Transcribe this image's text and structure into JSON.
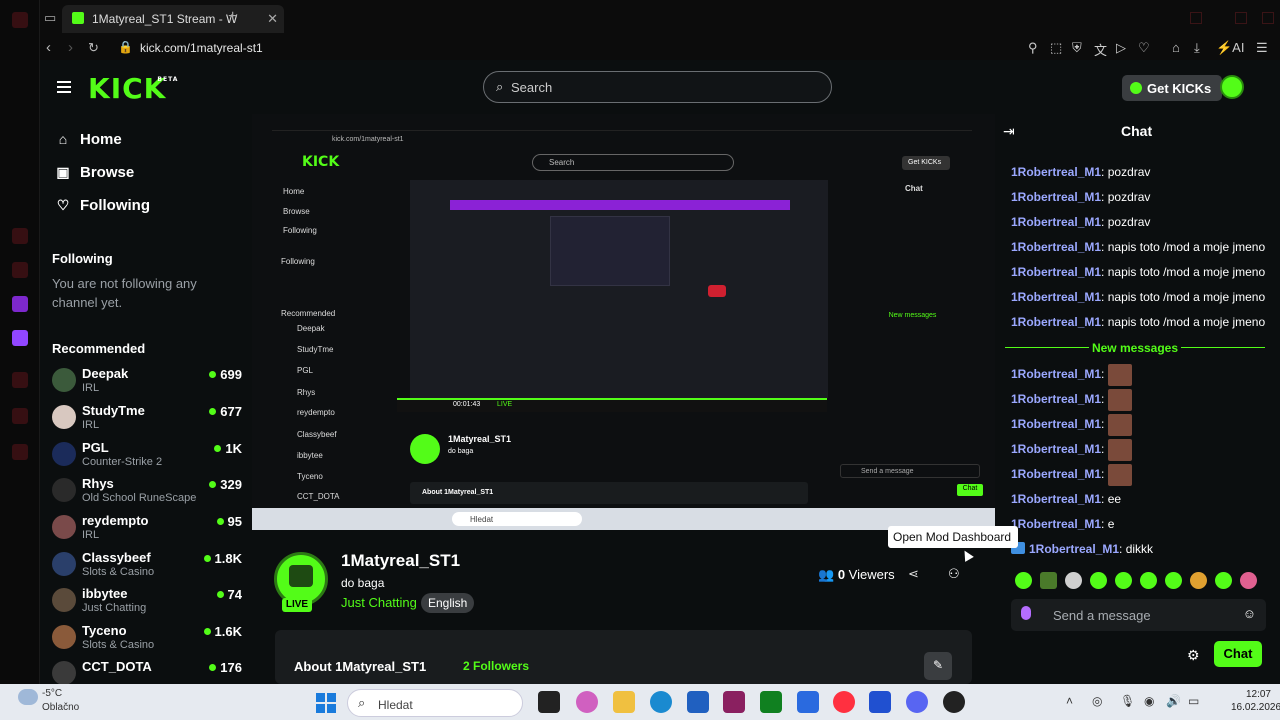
{
  "browser": {
    "tab_title": "1Matyreal_ST1 Stream - W",
    "url": "kick.com/1matyreal-st1"
  },
  "header": {
    "logo": "KICK",
    "logo_sup": "BETA",
    "search_placeholder": "Search",
    "get_kicks": "Get KICKs"
  },
  "sidebar": {
    "nav": [
      {
        "label": "Home",
        "icon": "home-icon"
      },
      {
        "label": "Browse",
        "icon": "browse-icon"
      },
      {
        "label": "Following",
        "icon": "heart-icon"
      }
    ],
    "following_heading": "Following",
    "not_following": "You are not following any channel yet.",
    "recommended_heading": "Recommended",
    "recommended": [
      {
        "name": "Deepak",
        "category": "IRL",
        "viewers": "699"
      },
      {
        "name": "StudyTme",
        "category": "IRL",
        "viewers": "677"
      },
      {
        "name": "PGL",
        "category": "Counter-Strike 2",
        "viewers": "1K"
      },
      {
        "name": "Rhys",
        "category": "Old School RuneScape",
        "viewers": "329"
      },
      {
        "name": "reydempto",
        "category": "IRL",
        "viewers": "95"
      },
      {
        "name": "Classybeef",
        "category": "Slots & Casino",
        "viewers": "1.8K"
      },
      {
        "name": "ibbytee",
        "category": "Just Chatting",
        "viewers": "74"
      },
      {
        "name": "Tyceno",
        "category": "Slots & Casino",
        "viewers": "1.6K"
      },
      {
        "name": "CCT_DOTA",
        "category": "",
        "viewers": "176"
      }
    ]
  },
  "channel": {
    "name": "1Matyreal_ST1",
    "title": "do baga",
    "category": "Just Chatting",
    "language": "English",
    "live": "LIVE",
    "viewers_count": "0",
    "viewers_label": "Viewers",
    "about": "About 1Matyreal_ST1",
    "followers": "2 Followers"
  },
  "tooltip": "Open Mod Dashboard",
  "chat": {
    "title": "Chat",
    "messages": [
      {
        "user": "1Robertreal_M1",
        "text": "pozdrav"
      },
      {
        "user": "1Robertreal_M1",
        "text": "pozdrav"
      },
      {
        "user": "1Robertreal_M1",
        "text": "pozdrav"
      },
      {
        "user": "1Robertreal_M1",
        "text": "napis toto /mod a moje jmeno"
      },
      {
        "user": "1Robertreal_M1",
        "text": "napis toto /mod a moje jmeno"
      },
      {
        "user": "1Robertreal_M1",
        "text": "napis toto /mod a moje jmeno"
      },
      {
        "user": "1Robertreal_M1",
        "text": "napis toto /mod a moje jmeno"
      }
    ],
    "new_messages": "New messages",
    "new": [
      {
        "user": "1Robertreal_M1",
        "text": ""
      },
      {
        "user": "1Robertreal_M1",
        "text": ""
      },
      {
        "user": "1Robertreal_M1",
        "text": ""
      },
      {
        "user": "1Robertreal_M1",
        "text": ""
      },
      {
        "user": "1Robertreal_M1",
        "text": ""
      },
      {
        "user": "1Robertreal_M1",
        "text": "ee"
      },
      {
        "user": "1Robertreal_M1",
        "text": "e"
      },
      {
        "user": "1Robertreal_M1",
        "text": "dikkk"
      }
    ],
    "input_placeholder": "Send a message",
    "send_label": "Chat"
  },
  "stream_preview": {
    "search": "Search",
    "get_kicks": "Get KICKs",
    "chat_title": "Chat",
    "timestamp": "00:01:43",
    "live": "LIVE",
    "taskbar_search": "Hledat"
  },
  "taskbar": {
    "temp": "-5°C",
    "weather": "Oblačno",
    "search": "Hledat",
    "time": "12:07",
    "date": "16.02.2026"
  },
  "colors": {
    "brand": "#53fc18",
    "username": "#9ba8ff",
    "background": "#0b0e0f"
  }
}
